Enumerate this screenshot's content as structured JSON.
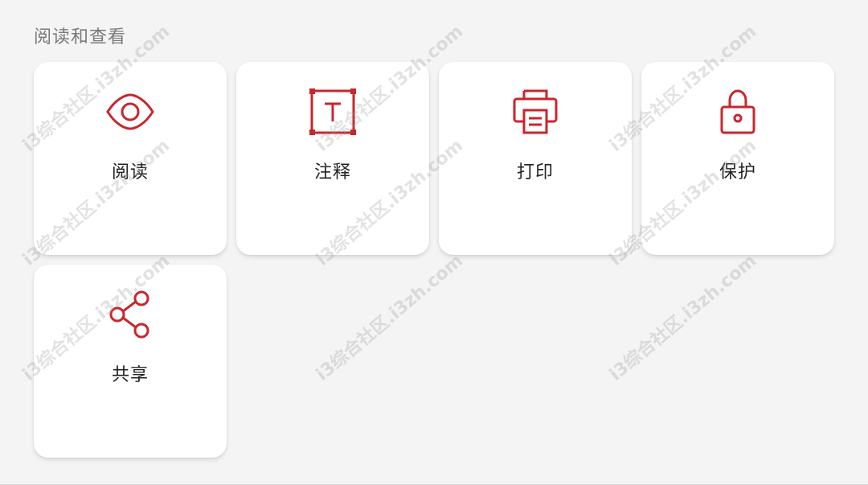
{
  "section": {
    "title": "阅读和查看"
  },
  "tiles": [
    {
      "label": "阅读",
      "icon": "eye-icon"
    },
    {
      "label": "注释",
      "icon": "annotate-text-box-icon"
    },
    {
      "label": "打印",
      "icon": "printer-icon"
    },
    {
      "label": "保护",
      "icon": "lock-icon"
    },
    {
      "label": "共享",
      "icon": "share-icon"
    }
  ],
  "colors": {
    "accent": "#c8262c",
    "background": "#f4f4f4",
    "tile": "#ffffff",
    "label": "#222222",
    "section_title": "#7a7a7a"
  },
  "watermark": {
    "text": "i3综合社区.i3zh.com"
  }
}
